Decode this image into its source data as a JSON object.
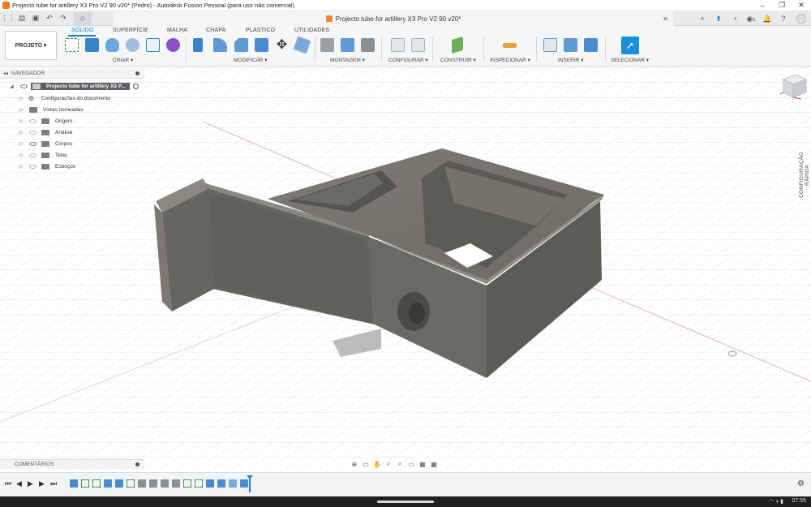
{
  "window": {
    "title": "Projecto tube for artillery X3 Pro V2 90 v20* (Pedro) - Autodesk Fusion Pessoal (para uso não comercial)",
    "minimize": "–",
    "maximize": "❐",
    "close": "✕"
  },
  "document_tab": {
    "title": "Projecto tube for artillery X3 Pro V2 90 v20*",
    "close": "✕"
  },
  "quick_access": {
    "badge_count": "1"
  },
  "ribbon": {
    "project_button": "PROJETO ▾",
    "tabs": [
      {
        "label": "SÓLIDO",
        "active": true
      },
      {
        "label": "SUPERFÍCIE",
        "active": false
      },
      {
        "label": "MALHA",
        "active": false
      },
      {
        "label": "CHAPA",
        "active": false
      },
      {
        "label": "PLÁSTICO",
        "active": false
      },
      {
        "label": "UTILIDADES",
        "active": false
      }
    ],
    "groups": [
      {
        "label": "CRIAR ▾"
      },
      {
        "label": "MODIFICAR ▾"
      },
      {
        "label": "MONTAGEM ▾"
      },
      {
        "label": "CONFIGURAR ▾"
      },
      {
        "label": "CONSTRUIR ▾"
      },
      {
        "label": "INSPECIONAR ▾"
      },
      {
        "label": "INSERIR ▾"
      },
      {
        "label": "SELECIONAR ▾"
      }
    ]
  },
  "navigator": {
    "header": "NAVEGADOR",
    "root": "Projecto tube for artillery X3 P...",
    "items": [
      {
        "label": "Configurações do documento"
      },
      {
        "label": "Vistas nomeadas"
      },
      {
        "label": "Origem"
      },
      {
        "label": "Análise"
      },
      {
        "label": "Corpos"
      },
      {
        "label": "Telas"
      },
      {
        "label": "Esboços"
      }
    ]
  },
  "side_panel": {
    "label": "CONFIGURAÇÃO RÁPIDA"
  },
  "comments": {
    "label": "COMENTÁRIOS"
  },
  "taskbar": {
    "time": "07:55"
  },
  "colors": {
    "accent": "#1a7fd8",
    "model": "#6f6d66",
    "grid": "#d6d8da"
  }
}
